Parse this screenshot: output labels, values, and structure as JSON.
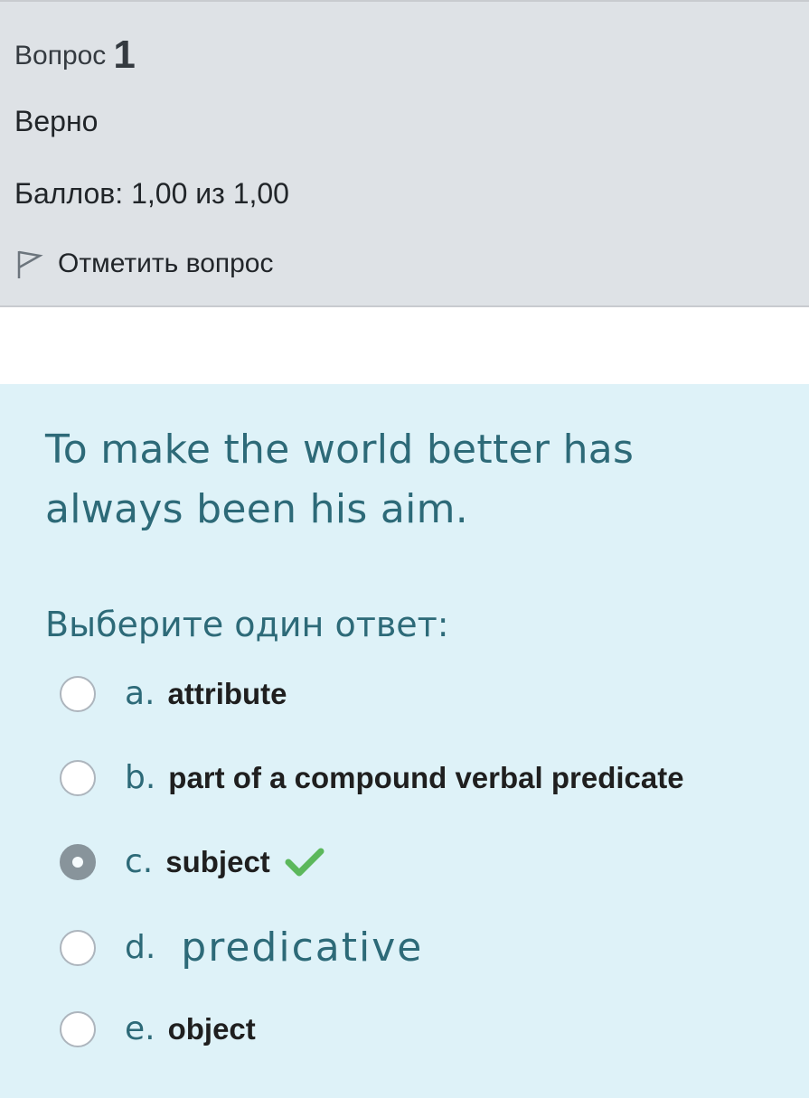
{
  "info": {
    "question_label": "Вопрос",
    "question_number": "1",
    "state": "Верно",
    "grade": "Баллов: 1,00 из 1,00",
    "flag_label": "Отметить вопрос"
  },
  "question": {
    "text": "To make the world better has always been his aim.",
    "prompt": "Выберите один ответ:",
    "options": [
      {
        "letter": "a.",
        "text": "attribute",
        "selected": false
      },
      {
        "letter": "b.",
        "text": "part of a compound verbal predicate",
        "selected": false
      },
      {
        "letter": "c.",
        "text": "subject",
        "selected": true,
        "correct_icon": "checkmark-icon"
      },
      {
        "letter": "d.",
        "text": "predicative",
        "selected": false
      },
      {
        "letter": "e.",
        "text": "object",
        "selected": false
      }
    ]
  },
  "colors": {
    "info_bg": "#dee2e6",
    "formulation_bg": "#def2f8",
    "question_text": "#2d6a78",
    "correct_green": "#5cb85c"
  }
}
